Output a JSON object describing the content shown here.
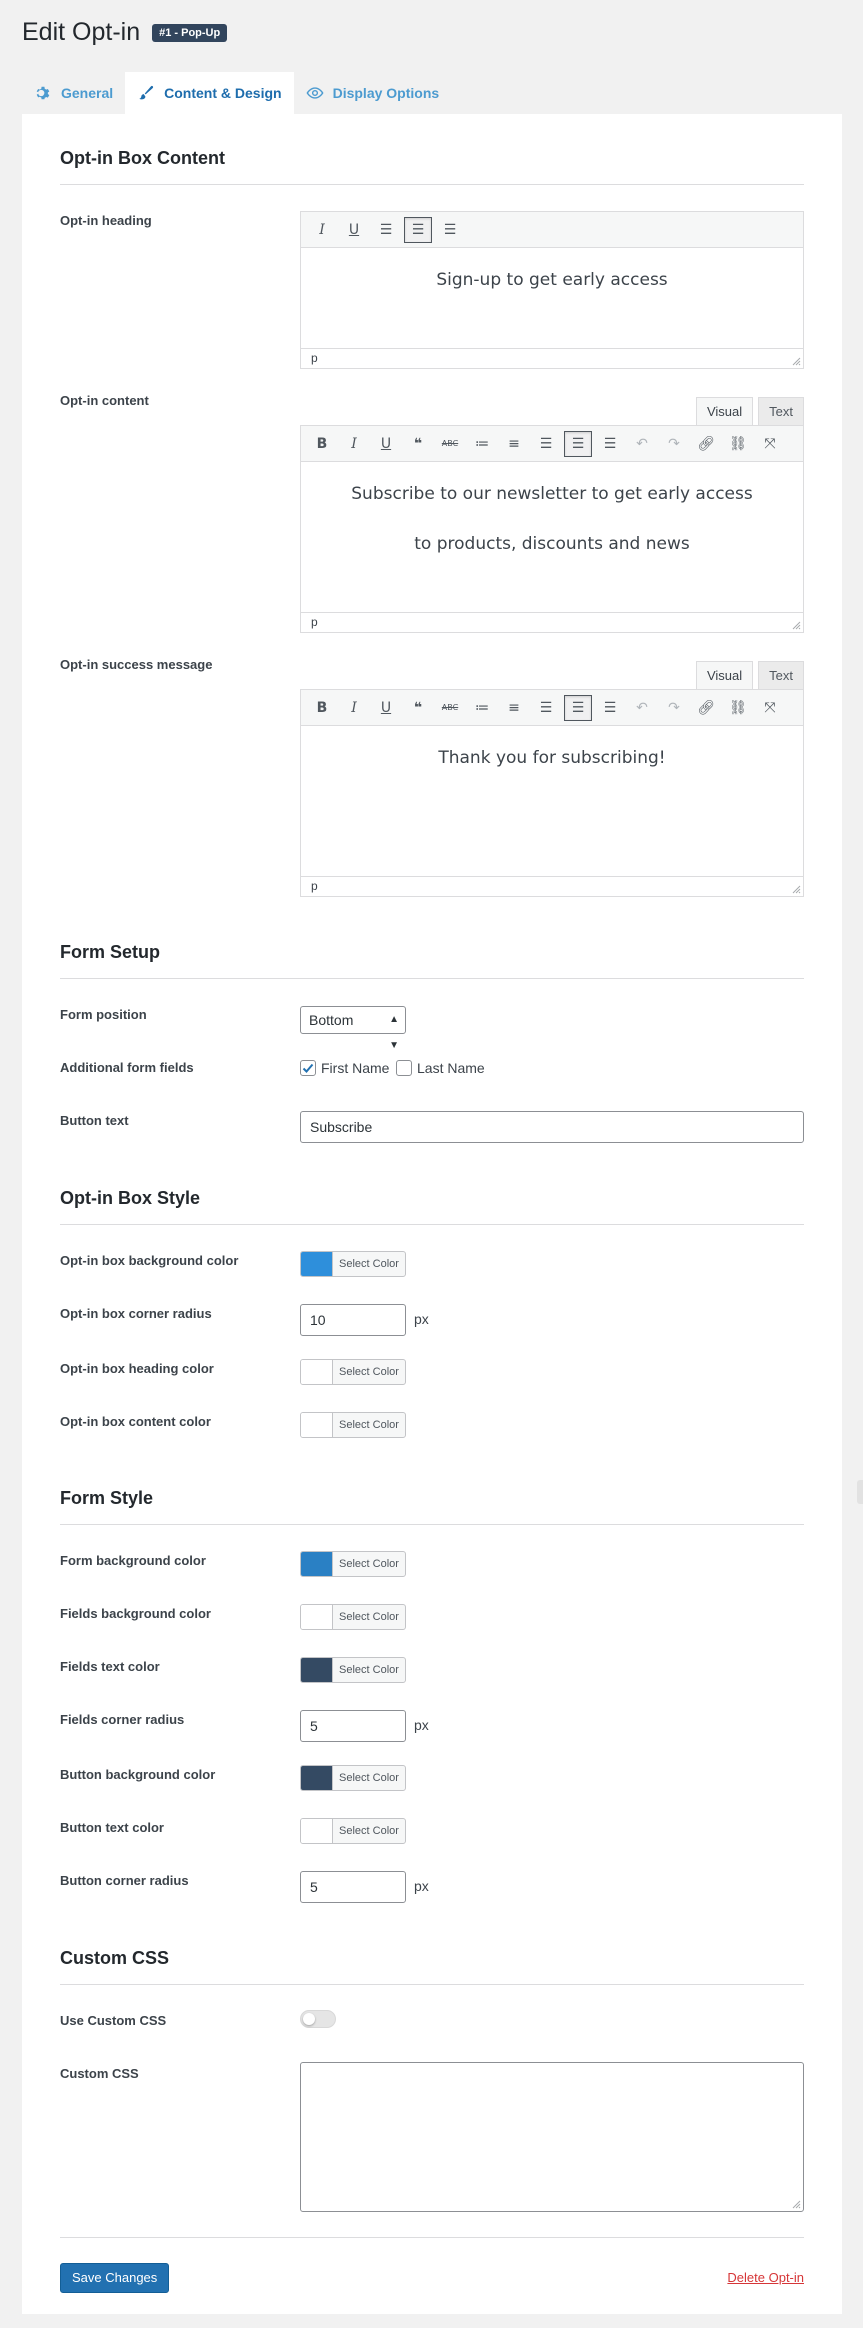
{
  "header": {
    "title": "Edit Opt-in",
    "badge": "#1 - Pop-Up"
  },
  "tabs": [
    {
      "label": "General",
      "icon": "gear-icon",
      "active": false
    },
    {
      "label": "Content & Design",
      "icon": "brush-icon",
      "active": true
    },
    {
      "label": "Display Options",
      "icon": "eye-icon",
      "active": false
    }
  ],
  "sections": {
    "content": "Opt-in Box Content",
    "form_setup": "Form Setup",
    "box_style": "Opt-in Box Style",
    "form_style": "Form Style",
    "custom_css": "Custom CSS"
  },
  "content": {
    "heading_label": "Opt-in heading",
    "heading_text": "Sign-up to get early access",
    "content_label": "Opt-in content",
    "content_line1": "Subscribe to our newsletter to get early access",
    "content_line2": "to products, discounts and news",
    "success_label": "Opt-in success message",
    "success_text": "Thank you for subscribing!",
    "status_tag": "p",
    "mode_visual": "Visual",
    "mode_text": "Text"
  },
  "form_setup": {
    "position_label": "Form position",
    "position_value": "Bottom",
    "fields_label": "Additional form fields",
    "first_name": "First Name",
    "first_name_checked": true,
    "last_name": "Last Name",
    "last_name_checked": false,
    "button_text_label": "Button text",
    "button_text_value": "Subscribe"
  },
  "box_style": {
    "bg_label": "Opt-in box background color",
    "bg_color": "#2e8fdb",
    "radius_label": "Opt-in box corner radius",
    "radius_value": "10",
    "heading_color_label": "Opt-in box heading color",
    "heading_color": "#ffffff",
    "content_color_label": "Opt-in box content color",
    "content_color": "#ffffff"
  },
  "form_style": {
    "form_bg_label": "Form background color",
    "form_bg_color": "#2a80c4",
    "fields_bg_label": "Fields background color",
    "fields_bg_color": "#ffffff",
    "fields_text_label": "Fields text color",
    "fields_text_color": "#344a63",
    "fields_radius_label": "Fields corner radius",
    "fields_radius_value": "5",
    "button_bg_label": "Button background color",
    "button_bg_color": "#344a63",
    "button_text_label": "Button text color",
    "button_text_color": "#ffffff",
    "button_radius_label": "Button corner radius",
    "button_radius_value": "5"
  },
  "custom_css": {
    "use_label": "Use Custom CSS",
    "enabled": false,
    "css_label": "Custom CSS",
    "css_value": ""
  },
  "common": {
    "select_color": "Select Color",
    "px": "px"
  },
  "footer": {
    "save": "Save Changes",
    "delete": "Delete Opt-in"
  }
}
